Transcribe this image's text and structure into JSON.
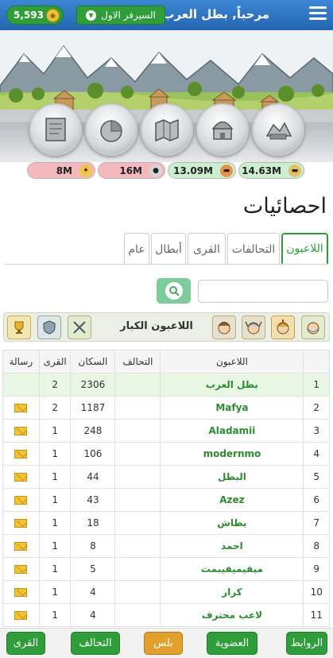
{
  "header": {
    "welcome": "مرحباً, بطل العرب",
    "server": "السيرفر الاول",
    "gold": "5,593"
  },
  "resources": [
    {
      "value": "14.63M",
      "icon": "wood-icon",
      "color": "#cbefcf"
    },
    {
      "value": "13.09M",
      "icon": "clay-icon",
      "color": "#cbefcf"
    },
    {
      "value": "16M",
      "icon": "iron-icon",
      "color": "#f4b8bd"
    },
    {
      "value": "8M",
      "icon": "crop-icon",
      "color": "#f4b8bd"
    }
  ],
  "page": {
    "title": "احصائيات"
  },
  "tabs": [
    "اللاعبون",
    "التحالفات",
    "القرى",
    "أبطال",
    "عام"
  ],
  "search": {
    "value": "",
    "placeholder": ""
  },
  "top_strip": {
    "title": "اللاعبون الكبار"
  },
  "table": {
    "headers": {
      "player": "اللاعبون",
      "alliance": "التحالف",
      "population": "السكان",
      "villages": "القرى",
      "message": "رسالة"
    },
    "rows": [
      {
        "rank": "1",
        "name": "بطل العرب",
        "alliance": "",
        "population": "2306",
        "villages": "2",
        "mail": false,
        "me": true
      },
      {
        "rank": "2",
        "name": "Mafya",
        "alliance": "",
        "population": "1187",
        "villages": "2",
        "mail": true,
        "me": false
      },
      {
        "rank": "3",
        "name": "Aladamii",
        "alliance": "",
        "population": "248",
        "villages": "1",
        "mail": true,
        "me": false
      },
      {
        "rank": "4",
        "name": "modernmo",
        "alliance": "",
        "population": "106",
        "villages": "1",
        "mail": true,
        "me": false
      },
      {
        "rank": "5",
        "name": "البطل",
        "alliance": "",
        "population": "44",
        "villages": "1",
        "mail": true,
        "me": false
      },
      {
        "rank": "6",
        "name": "Azez",
        "alliance": "",
        "population": "43",
        "villages": "1",
        "mail": true,
        "me": false
      },
      {
        "rank": "7",
        "name": "بطاش",
        "alliance": "",
        "population": "18",
        "villages": "1",
        "mail": true,
        "me": false
      },
      {
        "rank": "8",
        "name": "احمد",
        "alliance": "",
        "population": "8",
        "villages": "1",
        "mail": true,
        "me": false
      },
      {
        "rank": "9",
        "name": "ميقيميقيبمث",
        "alliance": "",
        "population": "5",
        "villages": "1",
        "mail": true,
        "me": false
      },
      {
        "rank": "10",
        "name": "كرار",
        "alliance": "",
        "population": "4",
        "villages": "1",
        "mail": true,
        "me": false
      },
      {
        "rank": "11",
        "name": "لاعب محترف",
        "alliance": "",
        "population": "4",
        "villages": "1",
        "mail": true,
        "me": false
      }
    ]
  },
  "bottom_nav": {
    "links": "الروابط",
    "membership": "العضوية",
    "plus": "بلس",
    "alliance": "التحالف",
    "villages": "القرى"
  }
}
